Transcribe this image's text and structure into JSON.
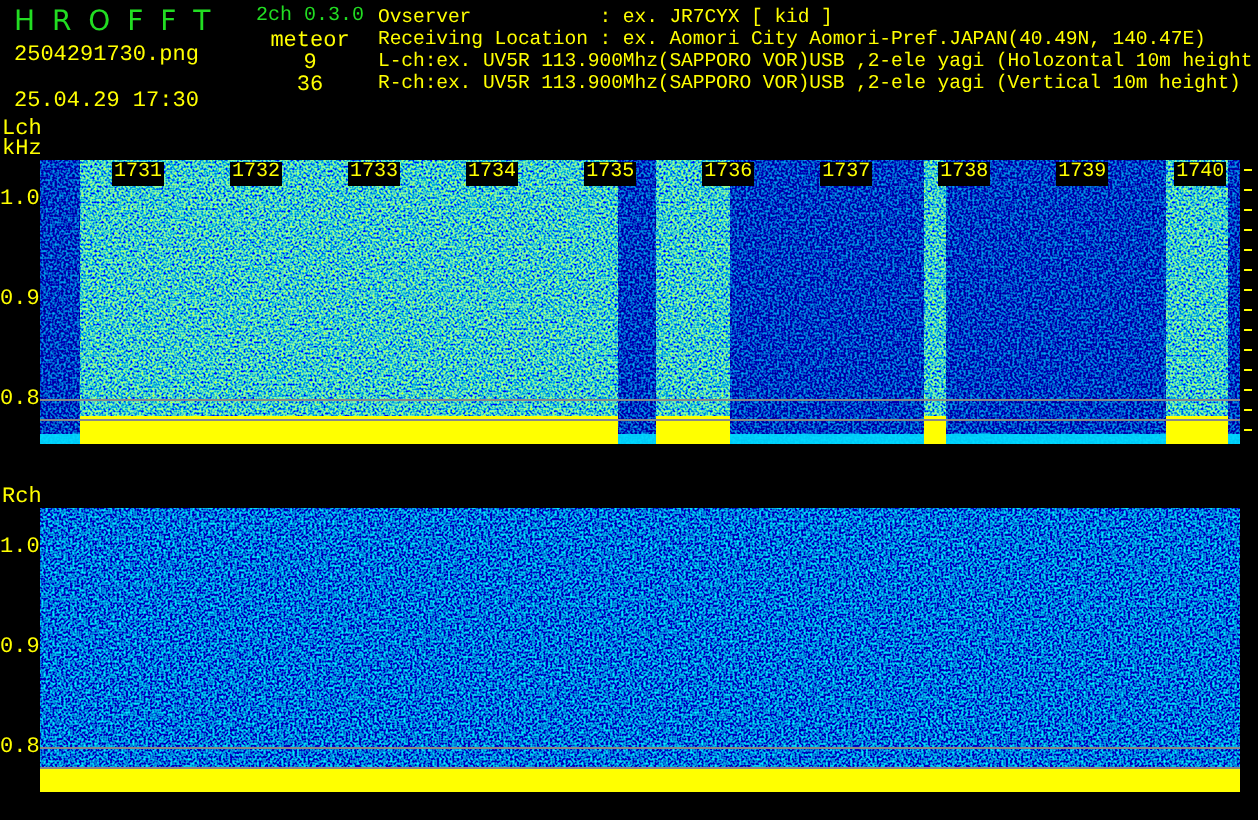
{
  "header": {
    "app_name": "H R O F F T",
    "version": "2ch 0.3.0",
    "filename": "2504291730.png",
    "count_label": "meteor",
    "l_count": "9",
    "timestamp": "25.04.29 17:30",
    "r_count": "36",
    "info_lines": [
      "Ovserver           : ex. JR7CYX [ kid ]",
      "Receiving Location : ex. Aomori City Aomori-Pref.JAPAN(40.49N, 140.47E)",
      "L-ch:ex. UV5R 113.900Mhz(SAPPORO VOR)USB ,2-ele yagi (Holozontal 10m height",
      "R-ch:ex. UV5R 113.900Mhz(SAPPORO VOR)USB ,2-ele yagi (Vertical 10m height)"
    ]
  },
  "panels": [
    {
      "kind": "bursts",
      "channel": "Lch",
      "unit": "kHz",
      "time_labels": [
        "1731",
        "1732",
        "1733",
        "1734",
        "1735",
        "1736",
        "1737",
        "1738",
        "1739",
        "1740"
      ],
      "y_labels": [
        "1.0",
        "0.9",
        "0.8"
      ]
    },
    {
      "kind": "noise",
      "channel": "Rch",
      "y_labels": [
        "1.0",
        "0.9",
        "0.8"
      ]
    }
  ]
}
